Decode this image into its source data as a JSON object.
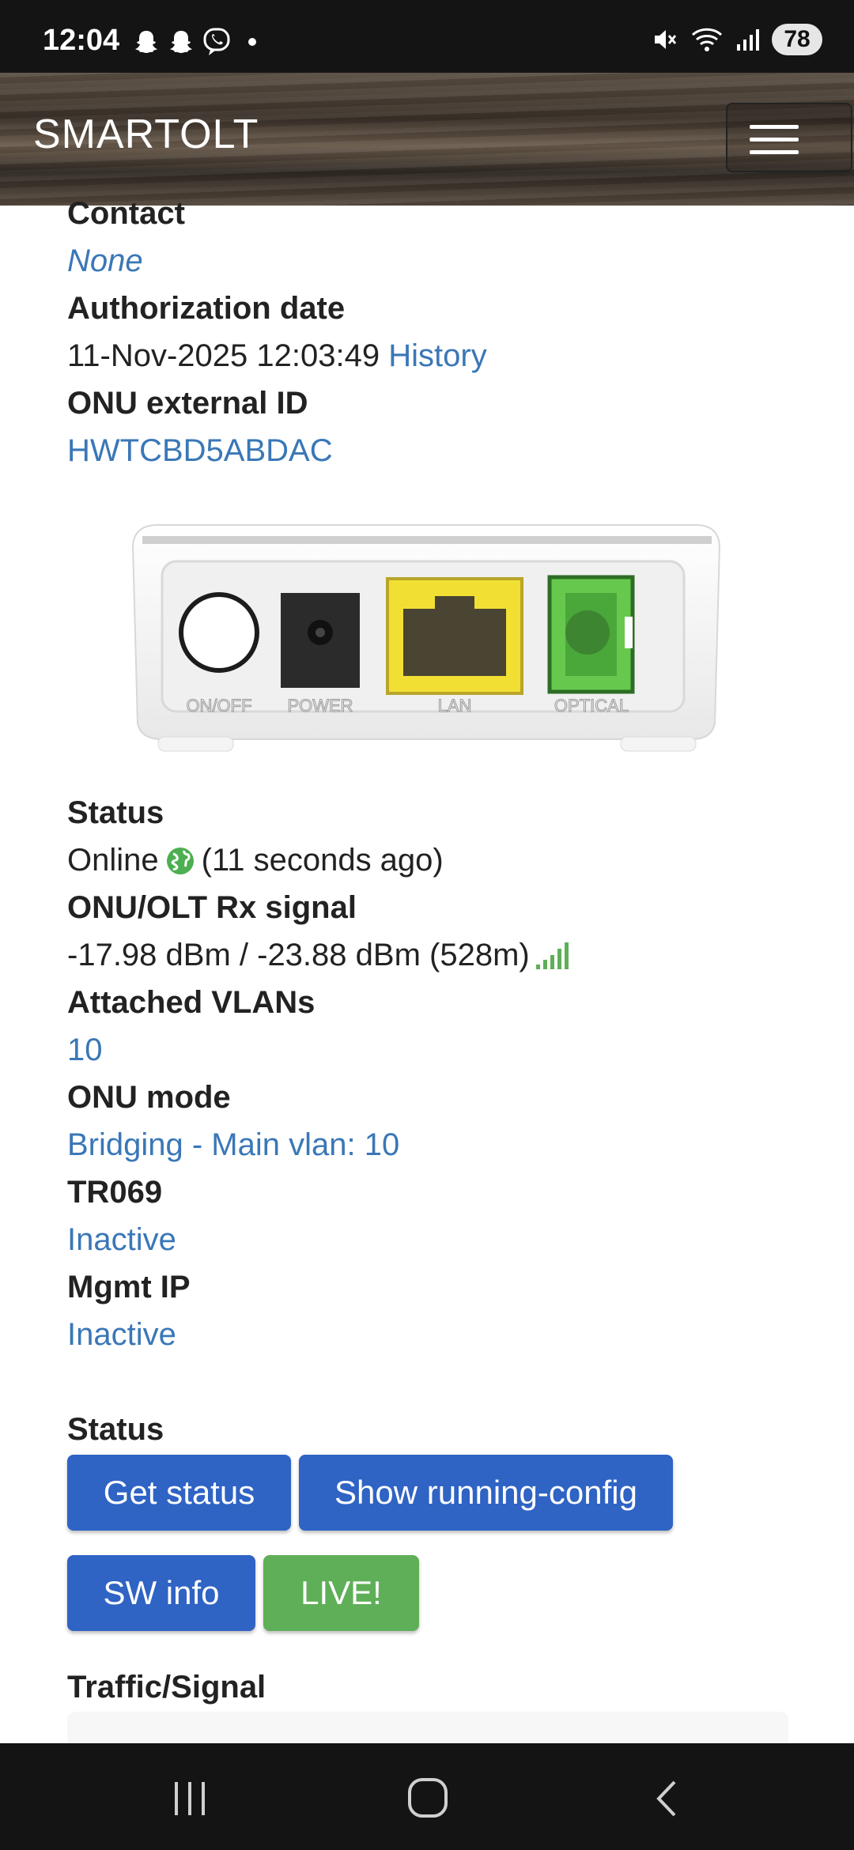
{
  "status_bar": {
    "time": "12:04",
    "notification_icons": [
      "snapchat-icon",
      "snapchat-icon",
      "viber-icon",
      "dot-icon"
    ],
    "right_icons": [
      "mute-icon",
      "wifi-icon",
      "signal-icon"
    ],
    "battery": "78"
  },
  "app": {
    "brand": "SMARTOLT",
    "menu_icon": "hamburger-icon"
  },
  "details": {
    "contact_label": "Contact",
    "contact_value": "None",
    "auth_date_label": "Authorization date",
    "auth_date_value": "11-Nov-2025 12:03:49",
    "history_link": "History",
    "external_id_label": "ONU external ID",
    "external_id_value": "HWTCBD5ABDAC"
  },
  "device": {
    "ports": [
      "ON/OFF",
      "POWER",
      "LAN",
      "OPTICAL"
    ]
  },
  "status": {
    "status_label": "Status",
    "status_value": "Online",
    "status_icon": "globe-icon",
    "status_ago": "(11 seconds ago)",
    "signal_label": "ONU/OLT Rx signal",
    "signal_value": "-17.98 dBm / -23.88 dBm (528m)",
    "signal_icon": "signal-bars-icon",
    "vlans_label": "Attached VLANs",
    "vlans_value": "10",
    "mode_label": "ONU mode",
    "mode_value": "Bridging - Main vlan: 10",
    "tr069_label": "TR069",
    "tr069_value": "Inactive",
    "mgmt_label": "Mgmt IP",
    "mgmt_value": "Inactive"
  },
  "actions": {
    "section_label": "Status",
    "get_status": "Get status",
    "show_running_config": "Show running-config",
    "sw_info": "SW info",
    "live": "LIVE!"
  },
  "traffic": {
    "section_label": "Traffic/Signal"
  },
  "colors": {
    "link": "#3a77b7",
    "button_blue": "#2f63c4",
    "button_green": "#5faf58",
    "online_green": "#4caf50"
  }
}
